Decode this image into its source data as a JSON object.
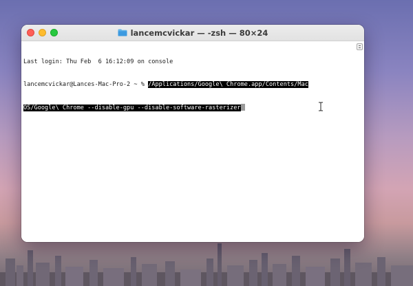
{
  "window": {
    "title": "lancemcvickar — -zsh — 80×24",
    "title_icon": "folder-icon"
  },
  "terminal": {
    "last_login": "Last login: Thu Feb  6 16:12:09 on console",
    "prompt": "lancemcvickar@Lances-Mac-Pro-2 ~ % ",
    "command_line1": "/Applications/Google\\ Chrome.app/Contents/Mac",
    "command_line2": "OS/Google\\ Chrome --disable-gpu --disable-software-rasterizer"
  },
  "colors": {
    "selection_bg": "#000000",
    "selection_fg": "#ffffff",
    "close": "#fe5f57",
    "minimize": "#febc2e",
    "maximize": "#28c840"
  }
}
